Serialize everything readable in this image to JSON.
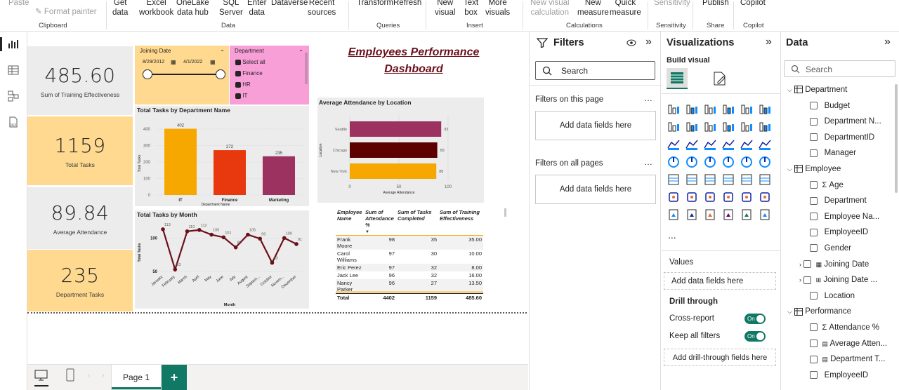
{
  "ribbon": {
    "clipboard": {
      "paste": "Paste",
      "format_painter": "Format painter",
      "group": "Clipboard"
    },
    "data": {
      "get_data": "Get\ndata",
      "excel": "Excel\nworkbook",
      "onelake": "OneLake\ndata hub",
      "sql": "SQL\nServer",
      "enter": "Enter\ndata",
      "dataverse": "Dataverse",
      "recent": "Recent\nsources",
      "group": "Data"
    },
    "queries": {
      "transform": "Transform",
      "refresh": "Refresh",
      "group": "Queries"
    },
    "insert": {
      "new_visual": "New\nvisual",
      "text_box": "Text\nbox",
      "more_visuals": "More\nvisuals",
      "group": "Insert"
    },
    "calculations": {
      "new_visual_calc": "New visual\ncalculation",
      "new_measure": "New\nmeasure",
      "quick_measure": "Quick\nmeasure",
      "group": "Calculations"
    },
    "sensitivity": {
      "label": "Sensitivity",
      "group": "Sensitivity"
    },
    "share": {
      "publish": "Publish",
      "group": "Share"
    },
    "copilot": {
      "label": "Copilot",
      "group": "Copilot"
    }
  },
  "cards": [
    {
      "value": "485.60",
      "label": "Sum of Training Effectiveness"
    },
    {
      "value": "1159",
      "label": "Total Tasks"
    },
    {
      "value": "89.84",
      "label": "Average Attendance"
    },
    {
      "value": "235",
      "label": "Department Tasks"
    }
  ],
  "dashboard_title_line1": "Employees Performance",
  "dashboard_title_line2": "Dashboard",
  "slicer_date": {
    "title": "Joining Date",
    "start": "8/29/2012",
    "end": "4/1/2022"
  },
  "slicer_dept": {
    "title": "Department",
    "items": [
      "Select all",
      "Finance",
      "HR",
      "IT"
    ]
  },
  "chart_data": [
    {
      "type": "bar",
      "title": "Total Tasks by Department Name",
      "xlabel": "Department Name",
      "ylabel": "Total Tasks",
      "categories": [
        "IT",
        "Finance",
        "Marketing"
      ],
      "values": [
        402,
        272,
        235
      ],
      "colors": [
        "#f7a800",
        "#e8380d",
        "#9c3260"
      ],
      "ylim": [
        0,
        400
      ],
      "yticks": [
        0,
        100,
        200,
        300,
        400
      ]
    },
    {
      "type": "bar",
      "orientation": "horizontal",
      "title": "Average Attendance by Location",
      "xlabel": "Average Attendance",
      "ylabel": "Location",
      "categories": [
        "Seattle",
        "Chicago",
        "New York"
      ],
      "values": [
        93,
        89,
        88
      ],
      "colors": [
        "#9c3260",
        "#5c0000",
        "#f7a800"
      ],
      "xlim": [
        0,
        100
      ],
      "xticks": [
        0,
        50,
        100
      ]
    },
    {
      "type": "line",
      "title": "Total Tasks by Month",
      "xlabel": "Month",
      "ylabel": "Total Tasks",
      "categories": [
        "January",
        "February",
        "March",
        "April",
        "May",
        "June",
        "July",
        "August",
        "Septem...",
        "October",
        "Novem...",
        "December"
      ],
      "values": [
        113,
        53,
        110,
        112,
        105,
        101,
        86,
        105,
        99,
        63,
        100,
        91
      ],
      "color": "#6b0f1a",
      "ylim": [
        50,
        115
      ],
      "yticks": [
        50,
        100
      ]
    }
  ],
  "table": {
    "headers": [
      "Employee Name",
      "Sum of Attendance %",
      "Sum of Tasks Completed",
      "Sum of Training Effectiveness"
    ],
    "rows": [
      [
        "Frank Moore",
        "98",
        "35",
        "35.00"
      ],
      [
        "Carol Williams",
        "97",
        "30",
        "10.00"
      ],
      [
        "Eric Perez",
        "97",
        "32",
        "8.00"
      ],
      [
        "Jack Lee",
        "96",
        "32",
        "16.00"
      ],
      [
        "Nancy Parker",
        "96",
        "27",
        "13.50"
      ]
    ],
    "total": [
      "Total",
      "4402",
      "1159",
      "485.60"
    ]
  },
  "page_tab": "Page 1",
  "filters": {
    "title": "Filters",
    "search": "Search",
    "on_page": "Filters on this page",
    "all_pages": "Filters on all pages",
    "add": "Add data fields here"
  },
  "visualizations": {
    "title": "Visualizations",
    "build": "Build visual",
    "values": "Values",
    "add_values": "Add data fields here",
    "drill": "Drill through",
    "cross": "Cross-report",
    "keep": "Keep all filters",
    "on": "On",
    "add_drill": "Add drill-through fields here",
    "more": "..."
  },
  "data_pane": {
    "title": "Data",
    "search": "Search",
    "tables": [
      {
        "name": "Department",
        "fields": [
          "Budget",
          "Department N...",
          "DepartmentID",
          "Manager"
        ]
      },
      {
        "name": "Employee",
        "fields": [
          "Age",
          "Department",
          "Employee Na...",
          "EmployeeID",
          "Gender",
          "Joining Date",
          "Joining Date ...",
          "Location"
        ]
      },
      {
        "name": "Performance",
        "fields": [
          "Attendance %",
          "Average Atten...",
          "Department T...",
          "EmployeeID"
        ]
      }
    ]
  }
}
